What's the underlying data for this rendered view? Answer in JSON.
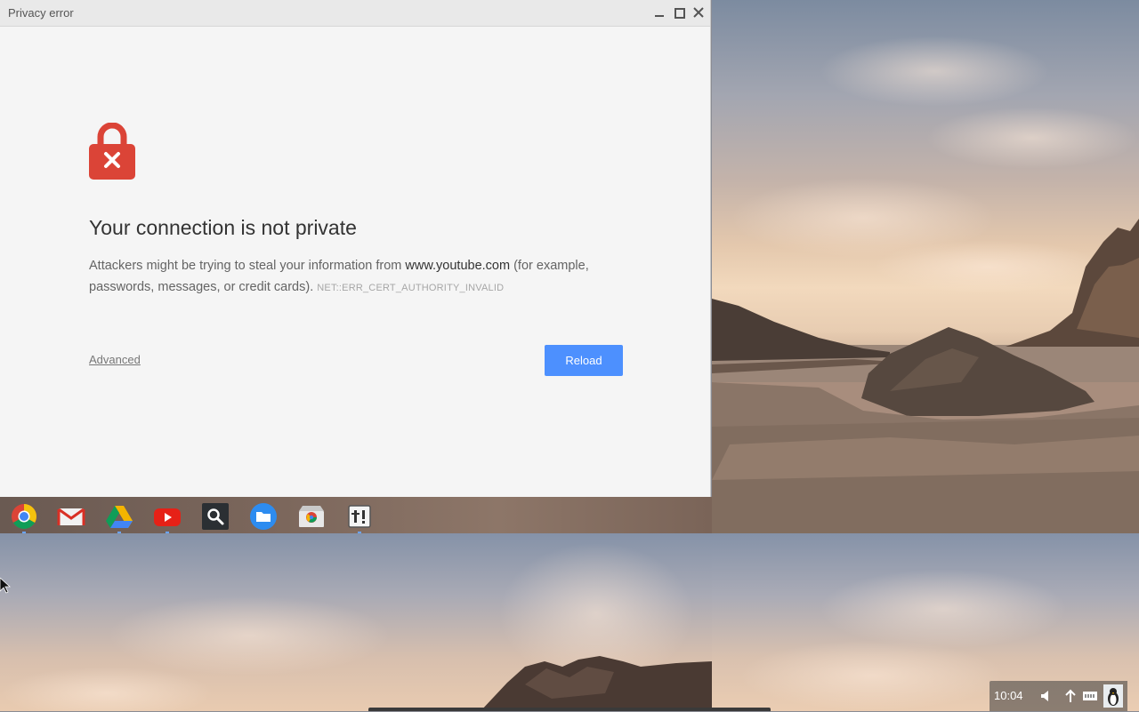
{
  "window": {
    "title": "Privacy error",
    "controls": [
      "minimize",
      "maximize",
      "close"
    ]
  },
  "error_page": {
    "heading": "Your connection is not private",
    "description_before": "Attackers might be trying to steal your information from ",
    "domain": "www.youtube.com",
    "description_after": " (for example, passwords, messages, or credit cards). ",
    "error_code": "NET::ERR_CERT_AUTHORITY_INVALID",
    "advanced_label": "Advanced",
    "reload_label": "Reload",
    "lock_color": "#db4437",
    "button_color": "#4d90fe"
  },
  "shelf": {
    "apps": [
      {
        "name": "chrome",
        "running": true
      },
      {
        "name": "gmail",
        "running": false
      },
      {
        "name": "google-drive",
        "running": true
      },
      {
        "name": "youtube",
        "running": true
      },
      {
        "name": "search",
        "running": false
      },
      {
        "name": "files",
        "running": false
      },
      {
        "name": "web-store",
        "running": false
      },
      {
        "name": "crosh",
        "running": true
      }
    ]
  },
  "tray": {
    "time": "10:04",
    "icons": [
      "volume-icon",
      "network-icon",
      "keyboard-icon",
      "avatar"
    ]
  }
}
